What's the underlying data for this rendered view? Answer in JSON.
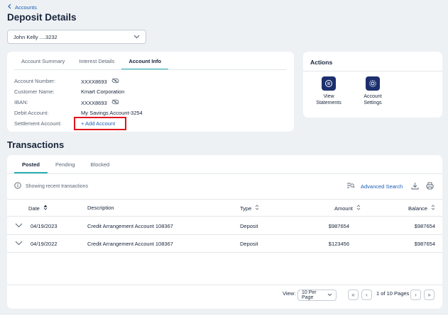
{
  "breadcrumb": {
    "label": "Accounts"
  },
  "page": {
    "title": "Deposit Details"
  },
  "account_select": {
    "value": "John Kelly ....3232"
  },
  "details": {
    "tabs": [
      "Account Summary",
      "Interest Details",
      "Account Info"
    ],
    "active_tab": "Account Info",
    "fields": [
      {
        "label": "Account Number:",
        "value": "XXXX8693"
      },
      {
        "label": "Customer Name:",
        "value": "Kmart Corporation"
      },
      {
        "label": "IBAN:",
        "value": "XXXX8693"
      },
      {
        "label": "Debit Account:",
        "value": "My Savings Account-3254"
      },
      {
        "label": "Settlement Account:",
        "value": "+ Add Account"
      }
    ]
  },
  "actions": {
    "title": "Actions",
    "items": [
      {
        "line1": "View",
        "line2": "Statements"
      },
      {
        "line1": "Account",
        "line2": "Settings"
      }
    ]
  },
  "transactions": {
    "title": "Transactions",
    "tabs": [
      "Posted",
      "Pending",
      "Blocked"
    ],
    "active_tab": "Posted",
    "info_text": "Showing recent transactions",
    "advanced_search": "Advanced Search",
    "columns": [
      "Date",
      "Description",
      "Type",
      "Amount",
      "Balance"
    ],
    "rows": [
      {
        "date": "04/19/2023",
        "description": "Credit Arrangement Account 108367",
        "type": "Deposit",
        "amount": "$987654",
        "balance": "$987654"
      },
      {
        "date": "04/19/2022",
        "description": "Credit Arrangement Account 108367",
        "type": "Deposit",
        "amount": "$123456",
        "balance": "$987654"
      }
    ],
    "pager": {
      "view_label": "View:",
      "per_page": "10 Per Page",
      "page_text": "1 of 10 Pages"
    }
  },
  "colors": {
    "accent": "#2aaeb6",
    "link": "#1a5fb4",
    "action_icon_bg": "#1c2f6e",
    "highlight": "#e0141e"
  }
}
